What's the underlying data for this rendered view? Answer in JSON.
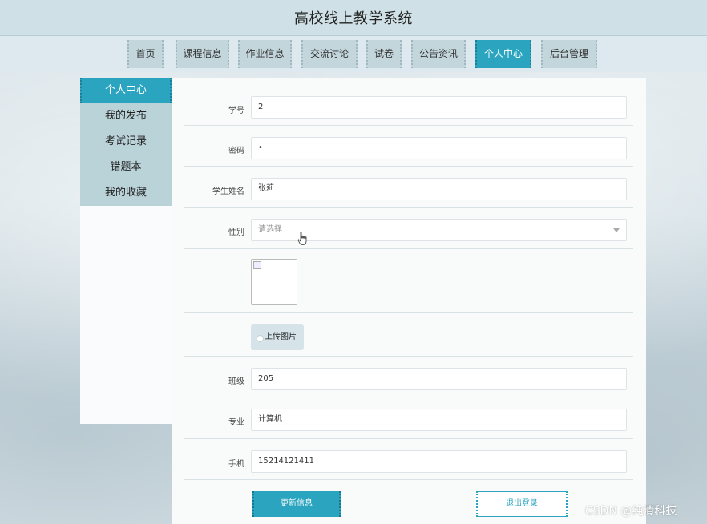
{
  "header": {
    "title": "高校线上教学系统"
  },
  "nav": {
    "items": [
      {
        "label": "首页",
        "active": false
      },
      {
        "label": "课程信息",
        "active": false
      },
      {
        "label": "作业信息",
        "active": false
      },
      {
        "label": "交流讨论",
        "active": false
      },
      {
        "label": "试卷",
        "active": false
      },
      {
        "label": "公告资讯",
        "active": false
      },
      {
        "label": "个人中心",
        "active": true
      },
      {
        "label": "后台管理",
        "active": false
      }
    ]
  },
  "sidebar": {
    "items": [
      {
        "label": "个人中心",
        "active": true
      },
      {
        "label": "我的发布",
        "active": false
      },
      {
        "label": "考试记录",
        "active": false
      },
      {
        "label": "错题本",
        "active": false
      },
      {
        "label": "我的收藏",
        "active": false
      }
    ]
  },
  "form": {
    "student_id": {
      "label": "学号",
      "value": "2"
    },
    "password": {
      "label": "密码",
      "value": "•"
    },
    "name": {
      "label": "学生姓名",
      "value": "张莉"
    },
    "gender": {
      "label": "性别",
      "placeholder": "请选择"
    },
    "upload_label": "上传图片",
    "class": {
      "label": "班级",
      "value": "205"
    },
    "major": {
      "label": "专业",
      "value": "计算机"
    },
    "phone": {
      "label": "手机",
      "value": "15214121411"
    }
  },
  "actions": {
    "update_label": "更新信息",
    "logout_label": "退出登录"
  },
  "watermark": "CSDN @纯清科技",
  "colors": {
    "accent": "#2aa4bf",
    "nav_bg": "#c3d6dc",
    "sidebar_bg": "#bad3d9"
  }
}
